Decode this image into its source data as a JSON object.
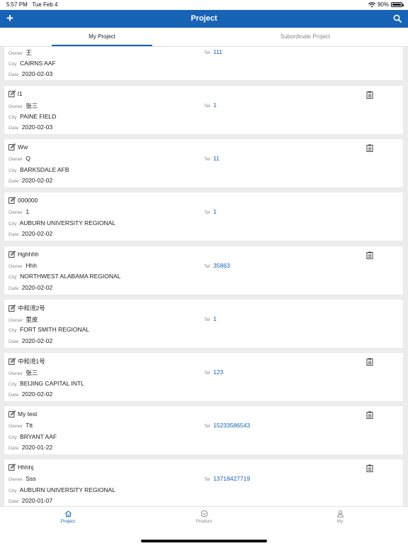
{
  "status": {
    "time": "5:57 PM",
    "date": "Tue Feb 4",
    "battery": "90%"
  },
  "nav": {
    "title": "Project",
    "add_icon": "plus-icon",
    "search_icon": "search-icon"
  },
  "tabs": [
    {
      "label": "My Project",
      "active": true
    },
    {
      "label": "Subordinate Project",
      "active": false
    }
  ],
  "labels": {
    "owner": "Owner",
    "city": "City",
    "date": "Date",
    "tel": "Tel"
  },
  "projects": [
    {
      "name": "",
      "owner": "王",
      "tel": "111",
      "city": "CAIRNS AAF",
      "date": "2020-02-03",
      "has_clipboard": false
    },
    {
      "name": "l1",
      "owner": "张三",
      "tel": "1",
      "city": "PAINE FIELD",
      "date": "2020-02-03",
      "has_clipboard": true
    },
    {
      "name": "Ww",
      "owner": "Q",
      "tel": "11",
      "city": "BARKSDALE AFB",
      "date": "2020-02-02",
      "has_clipboard": true
    },
    {
      "name": "000000",
      "owner": "1",
      "tel": "1",
      "city": "AUBURN UNIVERSITY REGIONAL",
      "date": "2020-02-02",
      "has_clipboard": false
    },
    {
      "name": "Hghhhh",
      "owner": "Hhh",
      "tel": "35863",
      "city": "NORTHWEST ALABAMA REGIONAL",
      "date": "2020-02-02",
      "has_clipboard": true
    },
    {
      "name": "中和湾2号",
      "owner": "里皮",
      "tel": "1",
      "city": "FORT SMITH REGIONAL",
      "date": "2020-02-02",
      "has_clipboard": false
    },
    {
      "name": "中和湾1号",
      "owner": "张三",
      "tel": "123",
      "city": "BEIJING CAPITAL INTL",
      "date": "2020-02-02",
      "has_clipboard": true
    },
    {
      "name": "My test",
      "owner": "Ttt",
      "tel": "15233586543",
      "city": "BRYANT AAF",
      "date": "2020-01-22",
      "has_clipboard": true
    },
    {
      "name": "Hhhhj",
      "owner": "Sss",
      "tel": "13718427719",
      "city": "AUBURN UNIVERSITY REGIONAL",
      "date": "2020-01-07",
      "has_clipboard": true
    }
  ],
  "bottom_tabs": [
    {
      "label": "Project",
      "icon": "home-icon",
      "active": true
    },
    {
      "label": "Product",
      "icon": "product-icon",
      "active": false
    },
    {
      "label": "My",
      "icon": "person-icon",
      "active": false
    }
  ],
  "colors": {
    "accent": "#1763b6",
    "background": "#ececec"
  }
}
